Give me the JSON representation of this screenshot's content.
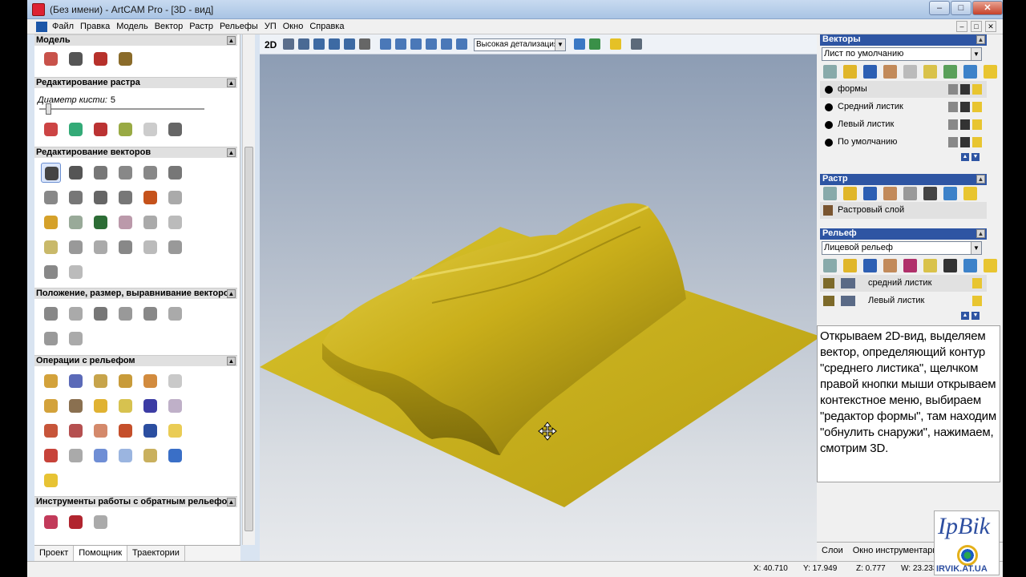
{
  "window": {
    "title": "(Без имени) - ArtCAM Pro - [3D - вид]",
    "min_label": "–",
    "max_label": "□",
    "close_label": "✕"
  },
  "menu": {
    "items": [
      "Файл",
      "Правка",
      "Модель",
      "Вектор",
      "Растр",
      "Рельефы",
      "УП",
      "Окно",
      "Справка"
    ],
    "right": [
      "–",
      "□",
      "✕"
    ]
  },
  "left_panel": {
    "model_title": "Модель",
    "raster_title": "Редактирование растра",
    "brush_label": "Диаметр кисти:",
    "brush_value": "5",
    "vector_title": "Редактирование векторов",
    "position_title": "Положение, размер, выравнивание векторов",
    "relief_ops_title": "Операции с рельефом",
    "reverse_title": "Инструменты работы с обратным рельефом",
    "tabs": [
      "Проект",
      "Помощник",
      "Траектории"
    ]
  },
  "view_toolbar": {
    "mode_2d": "2D",
    "detail_value": "Высокая детализация"
  },
  "right_panel": {
    "vectors": {
      "title": "Векторы",
      "sheet": "Лист по умолчанию",
      "layers": [
        "формы",
        "Средний листик",
        "Левый листик",
        "По умолчанию"
      ]
    },
    "raster": {
      "title": "Растр",
      "layer": "Растровый слой"
    },
    "relief": {
      "title": "Рельеф",
      "type": "Лицевой рельеф",
      "layers": [
        "средний листик",
        "Левый листик"
      ]
    },
    "note": "Открываем 2D-вид, выделяем вектор, определяющий контур \"среднего листика\", щелчком правой кнопки мыши открываем контекстное меню, выбираем \"редактор формы\", там находим \"обнулить снаружи\", нажимаем, смотрим 3D.",
    "tabs": [
      "Слои",
      "Окно инструментари"
    ]
  },
  "status": {
    "x": "X: 40.710",
    "y": "Y: 17.949",
    "z": "Z: 0.777",
    "w": "W: 23.233"
  },
  "logo": {
    "text": "IpBik",
    "url": "IRVIK.AT.UA"
  },
  "colors": {
    "relief_gold": "#c9b21a",
    "header_blue": "#2e55a3"
  }
}
